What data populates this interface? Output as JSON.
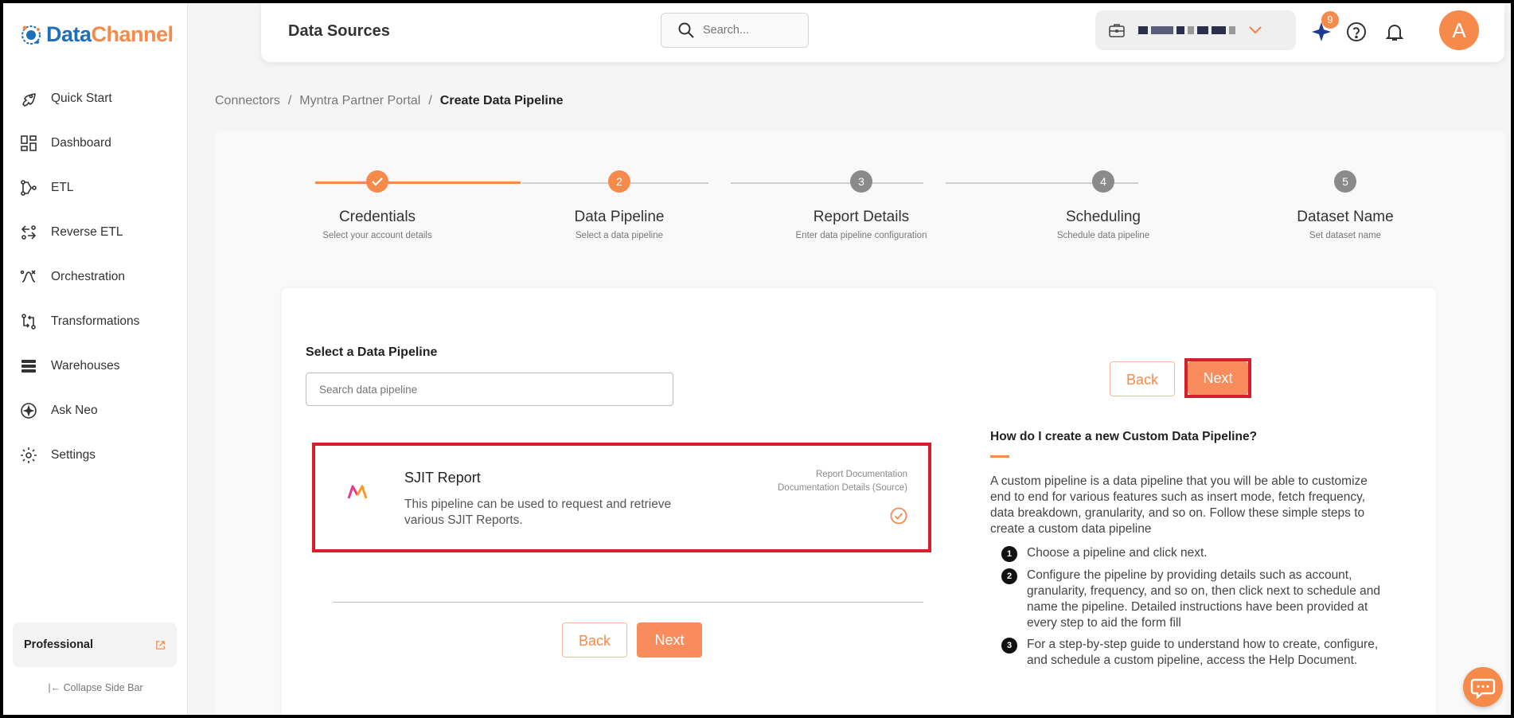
{
  "brand": {
    "name_part1": "Data",
    "name_part2": "Channel"
  },
  "sidebar": {
    "items": [
      {
        "label": "Quick Start"
      },
      {
        "label": "Dashboard"
      },
      {
        "label": "ETL"
      },
      {
        "label": "Reverse ETL"
      },
      {
        "label": "Orchestration"
      },
      {
        "label": "Transformations"
      },
      {
        "label": "Warehouses"
      },
      {
        "label": "Ask Neo"
      },
      {
        "label": "Settings"
      }
    ],
    "plan_label": "Professional",
    "collapse_label": "Collapse Side Bar"
  },
  "header": {
    "title": "Data Sources",
    "search_placeholder": "Search...",
    "notification_count": "9",
    "avatar_initial": "A"
  },
  "breadcrumb": {
    "items": [
      "Connectors",
      "Myntra Partner Portal"
    ],
    "separator": "/",
    "current": "Create Data Pipeline"
  },
  "stepper": {
    "steps": [
      {
        "number": "1",
        "title": "Credentials",
        "subtitle": "Select your account details",
        "state": "completed"
      },
      {
        "number": "2",
        "title": "Data Pipeline",
        "subtitle": "Select a data pipeline",
        "state": "active"
      },
      {
        "number": "3",
        "title": "Report Details",
        "subtitle": "Enter data pipeline configuration",
        "state": "pending"
      },
      {
        "number": "4",
        "title": "Scheduling",
        "subtitle": "Schedule data pipeline",
        "state": "pending"
      },
      {
        "number": "5",
        "title": "Dataset Name",
        "subtitle": "Set dataset name",
        "state": "pending"
      }
    ]
  },
  "pipeline": {
    "section_label": "Select a Data Pipeline",
    "search_placeholder": "Search data pipeline",
    "back_label": "Back",
    "next_label": "Next",
    "card": {
      "title": "SJIT Report",
      "description": "This pipeline can be used to request and retrieve various SJIT Reports.",
      "link_report": "Report Documentation",
      "link_details": "Documentation Details (Source)",
      "selected": true
    }
  },
  "help": {
    "title": "How do I create a new Custom Data Pipeline?",
    "intro": "A custom pipeline is a data pipeline that you will be able to customize end to end for various features such as insert mode, fetch frequency, data breakdown, granularity, and so on. Follow these simple steps to create a custom data pipeline",
    "steps": [
      {
        "number": "1",
        "text": "Choose a pipeline and click next."
      },
      {
        "number": "2",
        "text": "Configure the pipeline by providing details such as account, granularity, frequency, and so on, then click next to schedule and name the pipeline. Detailed instructions have been provided at every step to aid the form fill"
      },
      {
        "number": "3",
        "text": "For a step-by-step guide to understand how to create, configure, and schedule a custom pipeline, access the Help Document."
      }
    ]
  },
  "colors": {
    "accent": "#f58a4b",
    "brand_blue": "#1e6fb8",
    "highlight": "#d81e2c"
  }
}
